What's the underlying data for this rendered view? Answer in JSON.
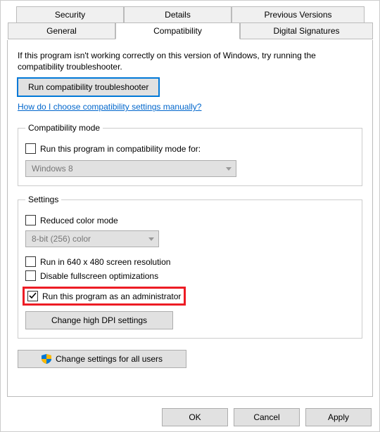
{
  "tabs": {
    "row2": [
      "Security",
      "Details",
      "Previous Versions"
    ],
    "row1": [
      "General",
      "Compatibility",
      "Digital Signatures"
    ],
    "active": "Compatibility"
  },
  "intro": "If this program isn't working correctly on this version of Windows, try running the compatibility troubleshooter.",
  "buttons": {
    "troubleshooter": "Run compatibility troubleshooter",
    "change_dpi": "Change high DPI settings",
    "change_all_users": "Change settings for all users",
    "ok": "OK",
    "cancel": "Cancel",
    "apply": "Apply"
  },
  "link": "How do I choose compatibility settings manually?",
  "compat_mode": {
    "legend": "Compatibility mode",
    "checkbox_label": "Run this program in compatibility mode for:",
    "select_value": "Windows 8"
  },
  "settings": {
    "legend": "Settings",
    "reduced_color": "Reduced color mode",
    "color_select": "8-bit (256) color",
    "run_640": "Run in 640 x 480 screen resolution",
    "disable_fullscreen": "Disable fullscreen optimizations",
    "run_admin": "Run this program as an administrator"
  }
}
